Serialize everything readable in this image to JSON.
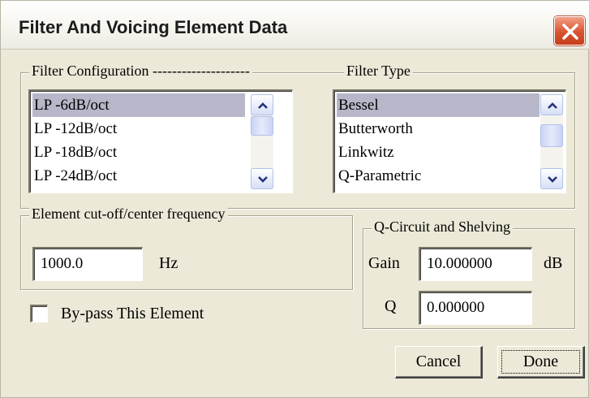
{
  "window": {
    "title": "Filter And Voicing Element Data"
  },
  "filter_config": {
    "legend": "Filter Configuration --------------------",
    "items": [
      "LP -6dB/oct",
      "LP -12dB/oct",
      "LP -18dB/oct",
      "LP -24dB/oct"
    ],
    "selected_index": 0
  },
  "filter_type": {
    "legend": "Filter Type",
    "items": [
      "Bessel",
      "Butterworth",
      "Linkwitz",
      "Q-Parametric"
    ],
    "selected_index": 0
  },
  "frequency": {
    "legend": "Element cut-off/center frequency",
    "value": "1000.0",
    "unit": "Hz"
  },
  "q_circuit": {
    "legend": "Q-Circuit and Shelving",
    "gain_label": "Gain",
    "gain_value": "10.000000",
    "gain_unit": "dB",
    "q_label": "Q",
    "q_value": "0.000000"
  },
  "bypass": {
    "label": "By-pass This Element",
    "checked": false
  },
  "buttons": {
    "cancel": "Cancel",
    "done": "Done"
  },
  "colors": {
    "selection": "#b7b7c9",
    "dialog_bg": "#ece9d8",
    "close_red": "#d9532f"
  }
}
